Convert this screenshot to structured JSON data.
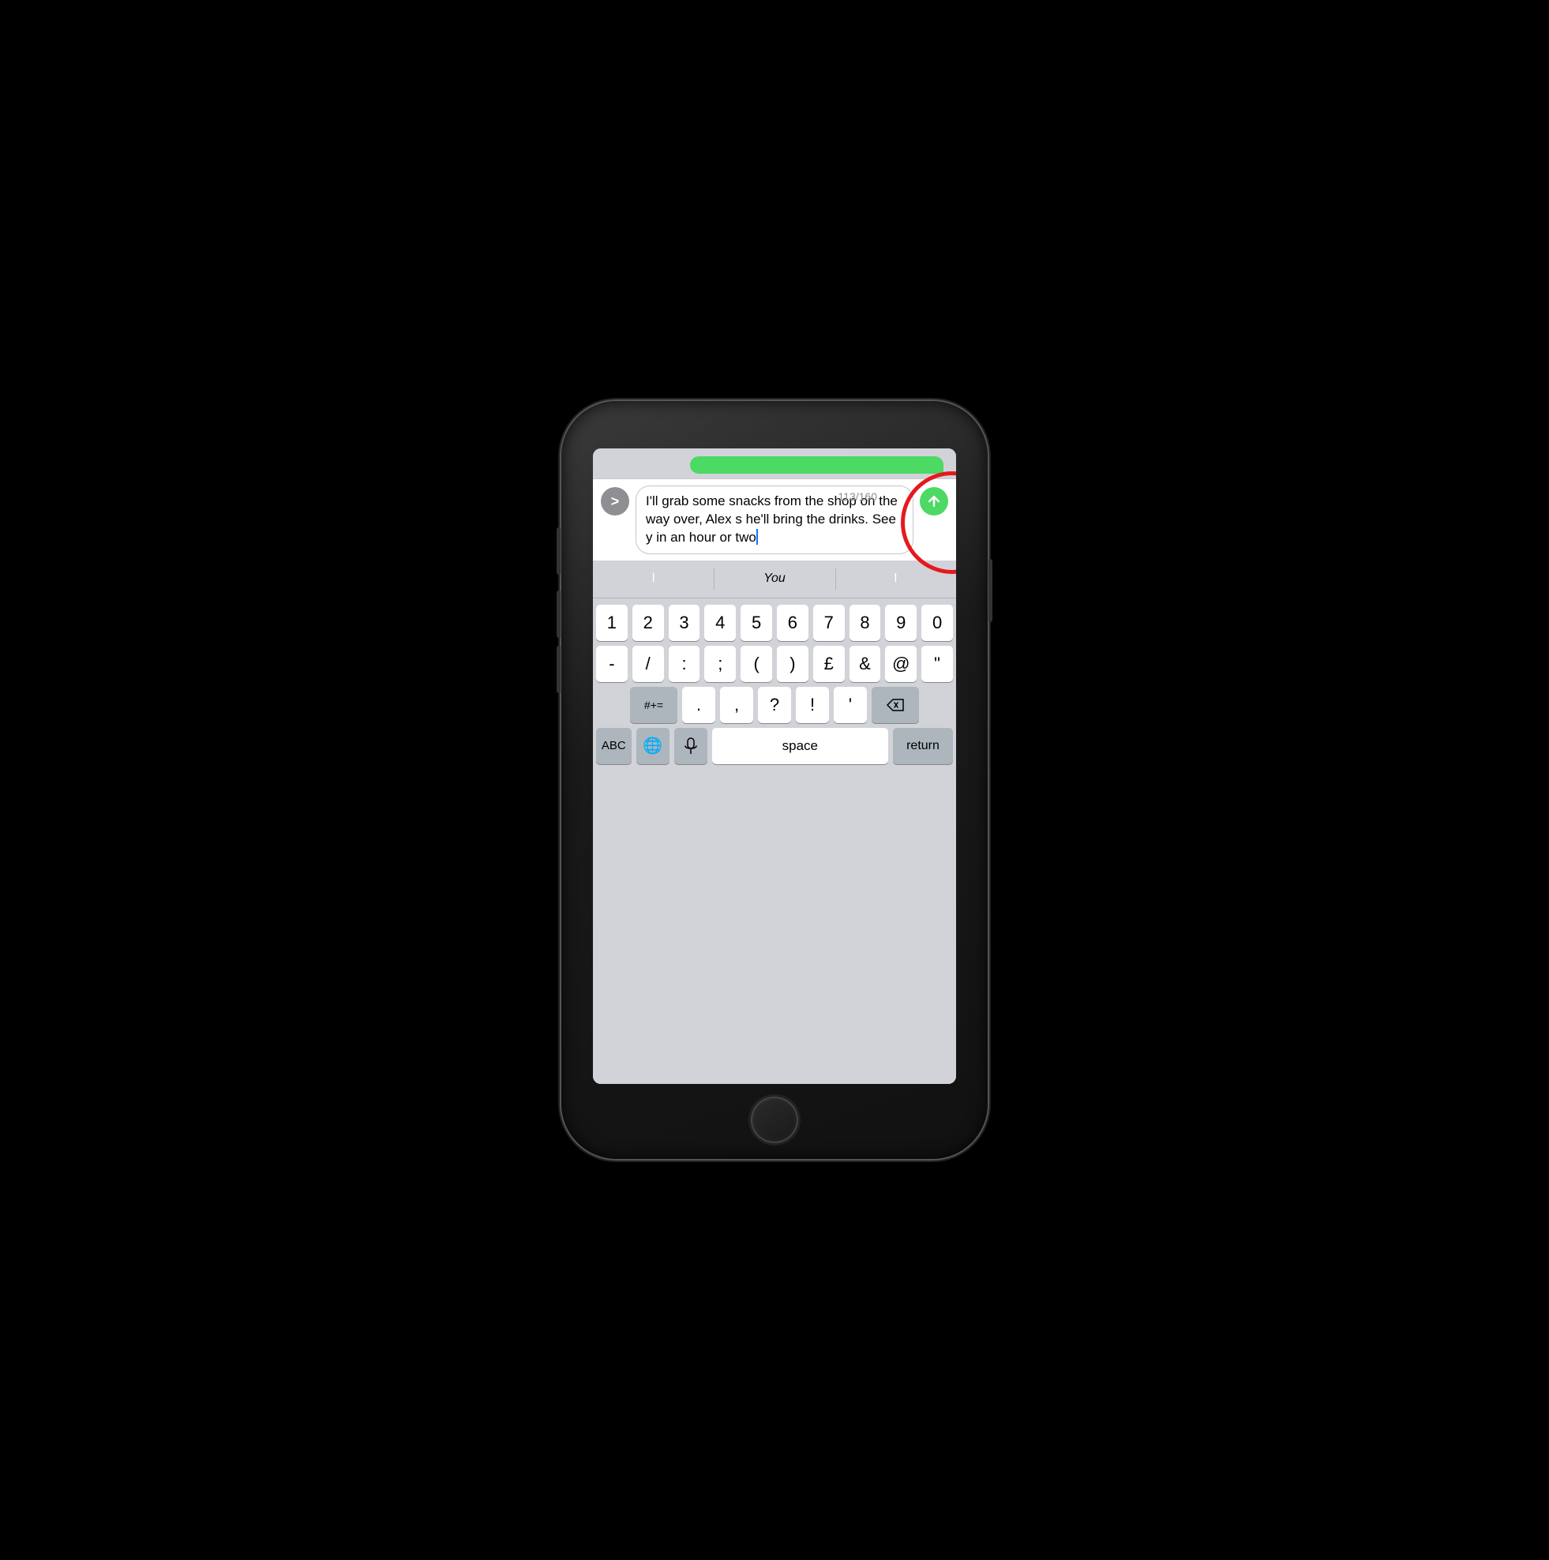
{
  "phone": {
    "screen": {
      "messages": {
        "green_bubble_visible": true
      },
      "compose": {
        "expand_btn_label": ">",
        "text": "I'll grab some snacks from the shop on the way over, Alex s he'll bring the drinks. See y in an hour or two!",
        "char_count": "113/160",
        "send_btn_label": "↑"
      },
      "autocorrect": {
        "items": [
          "l",
          "You",
          "I"
        ]
      },
      "keyboard": {
        "rows": [
          [
            "1",
            "2",
            "3",
            "4",
            "5",
            "6",
            "7",
            "8",
            "9",
            "0"
          ],
          [
            "-",
            "/",
            ":",
            ";",
            "(",
            ")",
            "£",
            "&",
            "@",
            "\""
          ],
          [
            "#+=",
            ".",
            ",",
            "?",
            "!",
            "'",
            "⌫"
          ],
          [
            "ABC",
            "🌐",
            "🎤",
            "space",
            "return"
          ]
        ]
      }
    }
  }
}
